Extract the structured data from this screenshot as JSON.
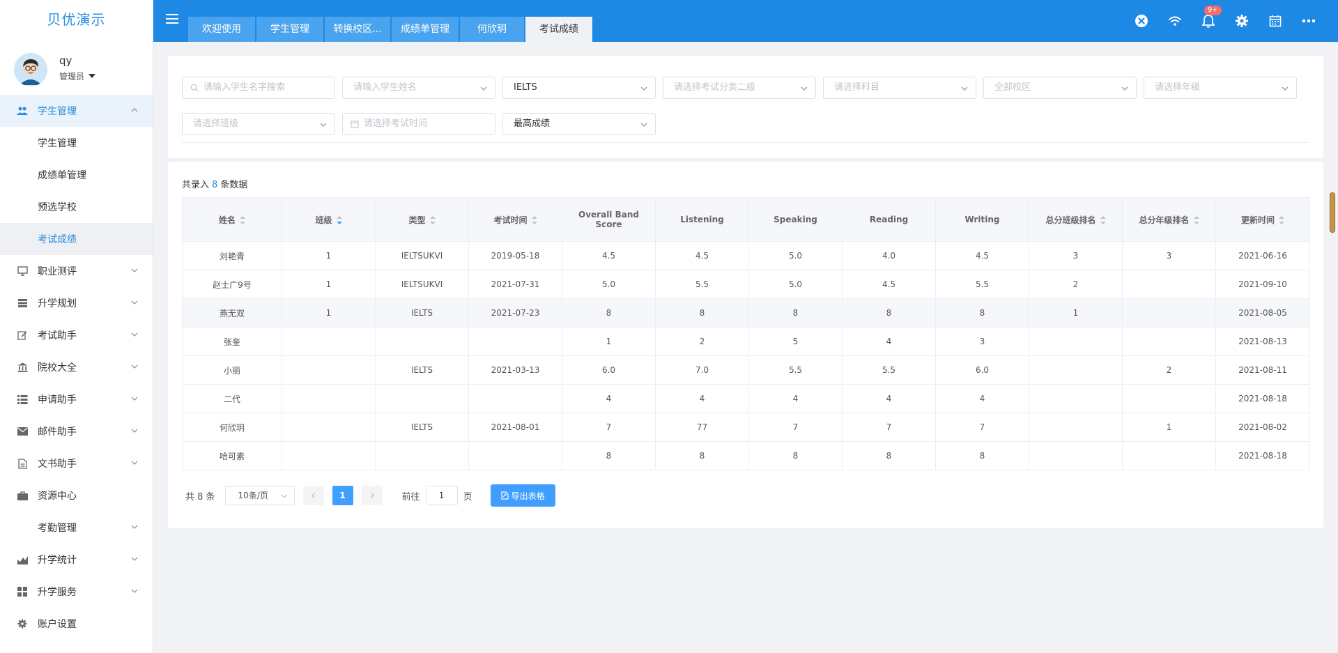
{
  "app": {
    "title": "贝优演示"
  },
  "user": {
    "name": "qy",
    "role": "管理员"
  },
  "sidebar": {
    "sections": [
      {
        "label": "学生管理",
        "icon": "users-icon",
        "open": true,
        "children": [
          "学生管理",
          "成绩单管理",
          "预选学校",
          "考试成绩"
        ],
        "active_child": 3
      },
      {
        "label": "职业测评",
        "icon": "monitor-icon"
      },
      {
        "label": "升学规划",
        "icon": "server-icon"
      },
      {
        "label": "考试助手",
        "icon": "edit-icon"
      },
      {
        "label": "院校大全",
        "icon": "bank-icon"
      },
      {
        "label": "申请助手",
        "icon": "list-icon"
      },
      {
        "label": "邮件助手",
        "icon": "mail-icon"
      },
      {
        "label": "文书助手",
        "icon": "document-icon"
      },
      {
        "label": "资源中心",
        "icon": "briefcase-icon"
      },
      {
        "label": "考勤管理",
        "icon": "none"
      },
      {
        "label": "升学统计",
        "icon": "chart-icon"
      },
      {
        "label": "升学服务",
        "icon": "grid-icon"
      },
      {
        "label": "账户设置",
        "icon": "gear-icon"
      }
    ]
  },
  "header": {
    "tabs": [
      "欢迎使用",
      "学生管理",
      "转换校区...",
      "成绩单管理",
      "何欣玥",
      "考试成绩"
    ],
    "active_tab": 5,
    "notification_badge": "9+"
  },
  "filters": {
    "row1": [
      {
        "placeholder": "请输入学生名字搜索",
        "value": "",
        "lead": "search"
      },
      {
        "placeholder": "请输入学生姓名",
        "value": ""
      },
      {
        "placeholder": "",
        "value": "IELTS"
      },
      {
        "placeholder": "请选择考试分类二级",
        "value": ""
      },
      {
        "placeholder": "请选择科目",
        "value": ""
      },
      {
        "placeholder": "全部校区",
        "value": ""
      },
      {
        "placeholder": "请选择年级",
        "value": ""
      }
    ],
    "row2": [
      {
        "placeholder": "请选择班级",
        "value": ""
      },
      {
        "placeholder": "请选择考试时间",
        "value": "",
        "lead": "calendar"
      },
      {
        "placeholder": "",
        "value": "最高成绩"
      }
    ]
  },
  "summary": {
    "prefix": "共录入",
    "count": "8",
    "suffix": "条数据"
  },
  "table": {
    "columns": [
      {
        "label": "姓名",
        "sortable": true
      },
      {
        "label": "班级",
        "sortable": true,
        "sort": "desc"
      },
      {
        "label": "类型",
        "sortable": true
      },
      {
        "label": "考试时间",
        "sortable": true
      },
      {
        "label": "Overall Band Score",
        "sortable": false
      },
      {
        "label": "Listening",
        "sortable": false
      },
      {
        "label": "Speaking",
        "sortable": false
      },
      {
        "label": "Reading",
        "sortable": false
      },
      {
        "label": "Writing",
        "sortable": false
      },
      {
        "label": "总分班级排名",
        "sortable": true
      },
      {
        "label": "总分年级排名",
        "sortable": true
      },
      {
        "label": "更新时间",
        "sortable": true
      }
    ],
    "rows": [
      [
        "刘艳青",
        "1",
        "IELTSUKVI",
        "2019-05-18",
        "4.5",
        "4.5",
        "5.0",
        "4.0",
        "4.5",
        "3",
        "3",
        "2021-06-16"
      ],
      [
        "赵士广9号",
        "1",
        "IELTSUKVI",
        "2021-07-31",
        "5.0",
        "5.5",
        "5.0",
        "4.5",
        "5.5",
        "2",
        "",
        "2021-09-10"
      ],
      [
        "燕无双",
        "1",
        "IELTS",
        "2021-07-23",
        "8",
        "8",
        "8",
        "8",
        "8",
        "1",
        "",
        "2021-08-05"
      ],
      [
        "张奎",
        "",
        "",
        "",
        "1",
        "2",
        "5",
        "4",
        "3",
        "",
        "",
        "2021-08-13"
      ],
      [
        "小丽",
        "",
        "IELTS",
        "2021-03-13",
        "6.0",
        "7.0",
        "5.5",
        "5.5",
        "6.0",
        "",
        "2",
        "2021-08-11"
      ],
      [
        "二代",
        "",
        "",
        "",
        "4",
        "4",
        "4",
        "4",
        "4",
        "",
        "",
        "2021-08-18"
      ],
      [
        "何欣玥",
        "",
        "IELTS",
        "2021-08-01",
        "7",
        "77",
        "7",
        "7",
        "7",
        "",
        "1",
        "2021-08-02"
      ],
      [
        "哈可素",
        "",
        "",
        "",
        "8",
        "8",
        "8",
        "8",
        "8",
        "",
        "",
        "2021-08-18"
      ]
    ],
    "highlighted_row": 2
  },
  "pagination": {
    "total_text": "共 8 条",
    "page_size": "10条/页",
    "current_page": "1",
    "goto_label": "前往",
    "goto_value": "1",
    "page_suffix": "页",
    "export_label": "导出表格"
  },
  "colors": {
    "header": "#1e88e5",
    "accent": "#409eff",
    "link": "#2b6ab8"
  }
}
